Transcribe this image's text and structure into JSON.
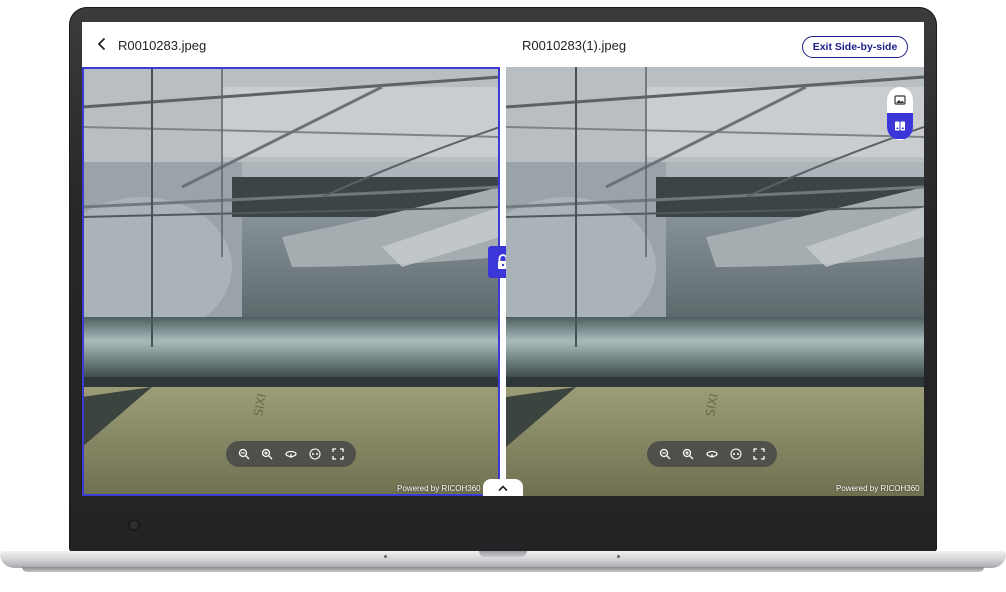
{
  "header": {
    "left_title": "R0010283.jpeg",
    "right_title": "R0010283(1).jpeg",
    "exit_label": "Exit Side-by-side"
  },
  "viewer": {
    "powered_by": "Powered by RICOH360",
    "toolbar_icons": [
      "zoom-out-icon",
      "zoom-in-icon",
      "rotate-icon",
      "vr-icon",
      "fullscreen-icon"
    ],
    "view_modes": [
      "image-view-icon",
      "split-view-icon"
    ],
    "active_view_mode": "split-view-icon"
  },
  "colors": {
    "accent": "#3a36d8",
    "exit_button": "#1e1e88",
    "selected_border": "#3b3bd4"
  }
}
